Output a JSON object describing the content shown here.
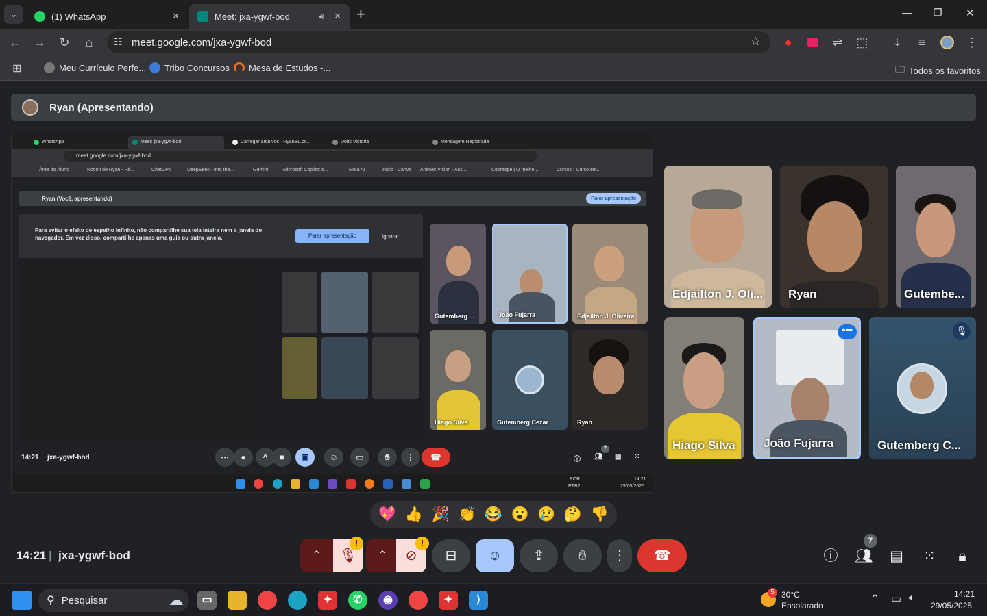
{
  "browser": {
    "tabs": [
      {
        "title": "(1) WhatsApp",
        "active": false
      },
      {
        "title": "Meet: jxa-ygwf-bod",
        "active": true
      }
    ],
    "new_tab": "+",
    "window_controls": {
      "minimize": "—",
      "maximize": "❐",
      "close": "✕"
    },
    "url": "meet.google.com/jxa-ygwf-bod",
    "bookmarks": [
      "Meu Currículo Perfe...",
      "Tribo Concursos",
      "Mesa de Estudos -..."
    ],
    "all_bookmarks": "Todos os favoritos"
  },
  "meet": {
    "presenter_bar": "Ryan (Apresentando)",
    "meeting_time": "14:21",
    "meeting_code": "jxa-ygwf-bod",
    "participant_count": "7",
    "participants": [
      {
        "name": "Edjailton J. Oli...",
        "muted": false
      },
      {
        "name": "Ryan",
        "muted": false
      },
      {
        "name": "Gutembe...",
        "muted": false
      },
      {
        "name": "Hiago Silva",
        "muted": false
      },
      {
        "name": "João Fujarra",
        "muted": false,
        "speaking": true,
        "more": "•••"
      },
      {
        "name": "Gutemberg C...",
        "muted": true
      }
    ],
    "reactions": [
      "💖",
      "👍",
      "🎉",
      "👏",
      "😂",
      "😮",
      "😢",
      "🤔",
      "👎"
    ],
    "controls": {
      "mic_warning": "!",
      "cam_warning": "!",
      "more": "⋮"
    }
  },
  "shared_screen": {
    "tabs": [
      "WhatsApp",
      "Meet: jxa-ygwf-bod",
      "Carregar arquivos · RyanBL.co...",
      "Doits Vistoria",
      "Mensagem Registrada"
    ],
    "url": "meet.google.com/jxa-ygwf-bod",
    "bookmarks": [
      "Área do Aluno",
      "Notion de Ryan - Pá...",
      "ChatGPT",
      "DeepSeek - Into the...",
      "Gemini",
      "Microsoft Copilot: s...",
      "Meta AI",
      "Início - Canva",
      "Animes Vision - Assi...",
      "Cebraspe | O melho...",
      "Cursos - Curso em..."
    ],
    "presenter_bar": "Ryan (Você, apresentando)",
    "stop_button": "Parar apresentação",
    "warning_text": "Para evitar o efeito de espelho infinito, não compartilhe sua tela inteira nem a janela do navegador. Em vez disso, compartilhe apenas uma guia ou outra janela.",
    "warning_button": "Parar apresentação",
    "warning_ignore": "Ignorar",
    "tiles": [
      "Gutemberg ...",
      "João Fujarra",
      "Edjailton J. Oliveira",
      "Hiago Silva",
      "Gutemberg Cezar",
      "Ryan"
    ],
    "time": "14:21",
    "code": "jxa-ygwf-bod",
    "participant_count": "7",
    "lang": "POR",
    "lang2": "PTB2",
    "clock_time": "14:21",
    "clock_date": "29/05/2025"
  },
  "taskbar": {
    "search_placeholder": "Pesquisar",
    "weather_badge": "5",
    "temperature": "30°C",
    "weather": "Ensolarado",
    "time": "14:21",
    "date": "29/05/2025"
  }
}
